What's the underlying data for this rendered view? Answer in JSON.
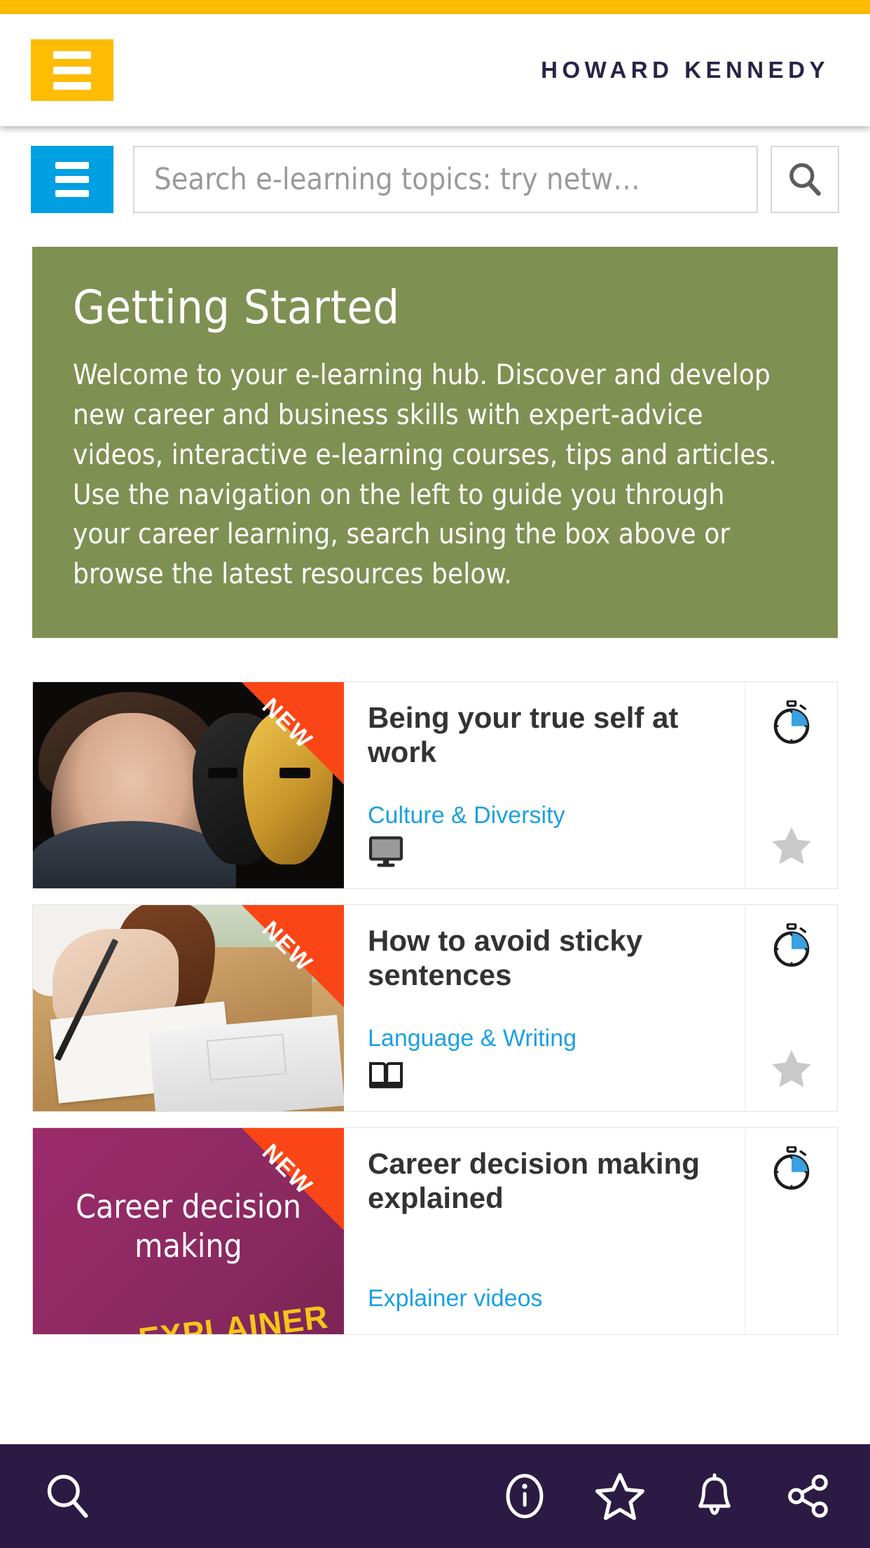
{
  "top_bar": {
    "color": "#FFBC05"
  },
  "header": {
    "menu_icon": "hamburger-icon",
    "brand": "HOWARD KENNEDY",
    "brand_color": "#2A2347"
  },
  "search": {
    "menu_icon": "hamburger-icon",
    "placeholder": "Search e-learning topics: try netw…",
    "value": "",
    "button_icon": "search-icon",
    "accent_color": "#00A0E3"
  },
  "hero": {
    "title": "Getting Started",
    "body": "Welcome to your e-learning hub. Discover and develop new career and business skills with expert-advice videos, interactive e-learning courses, tips and articles. Use the navigation on the left to guide you through your career learning, search using the box above or browse the latest resources below.",
    "background": "#7F9053",
    "text_color": "#FFFFFF"
  },
  "cards": [
    {
      "badge": "NEW",
      "title": "Being your true self at work",
      "category": "Culture & Diversity",
      "type_icon": "monitor-icon",
      "type_glyph": "🖥",
      "duration_icon": "stopwatch-icon",
      "favourite_icon": "star-icon",
      "favourite_active": false
    },
    {
      "badge": "NEW",
      "title": "How to avoid sticky sentences",
      "category": "Language & Writing",
      "type_icon": "book-icon",
      "type_glyph": "📖",
      "duration_icon": "stopwatch-icon",
      "favourite_icon": "star-icon",
      "favourite_active": false
    },
    {
      "badge": "NEW",
      "title": "Career decision making explained",
      "category": "Explainer videos",
      "type_icon": "video-icon",
      "type_glyph": "",
      "duration_icon": "stopwatch-icon",
      "favourite_icon": "star-icon",
      "favourite_active": false,
      "thumbnail_text": "Career decision making",
      "thumbnail_overlay_text": "EXPLAINER"
    }
  ],
  "badge_color": "#FA4616",
  "category_color": "#1BA0E1",
  "bottom_nav": {
    "background": "#2B1B44",
    "left": [
      {
        "icon": "search-icon",
        "name": "search"
      }
    ],
    "right": [
      {
        "icon": "info-icon",
        "name": "information"
      },
      {
        "icon": "star-icon",
        "name": "favourites"
      },
      {
        "icon": "bell-icon",
        "name": "notifications"
      },
      {
        "icon": "share-icon",
        "name": "share"
      }
    ]
  }
}
